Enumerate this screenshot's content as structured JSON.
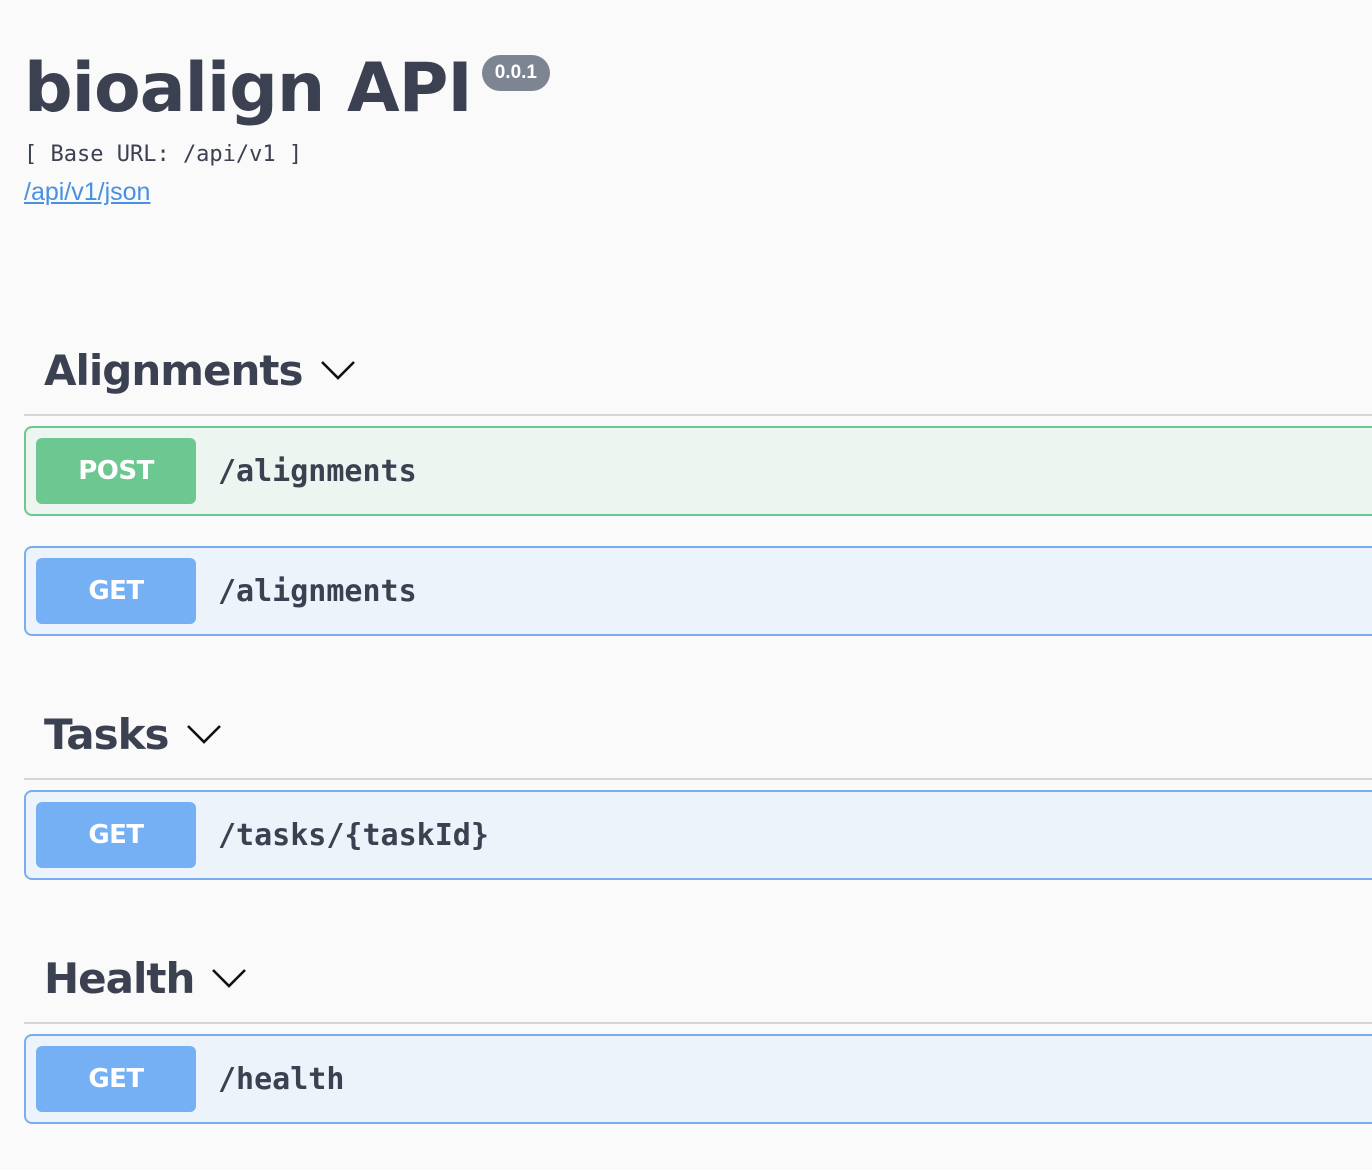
{
  "info": {
    "title": "bioalign API",
    "version": "0.0.1",
    "base_url": "[ Base URL: /api/v1 ]",
    "spec_link": "/api/v1/json"
  },
  "tags": [
    {
      "name": "Alignments",
      "operations": [
        {
          "method": "POST",
          "path": "/alignments"
        },
        {
          "method": "GET",
          "path": "/alignments"
        }
      ]
    },
    {
      "name": "Tasks",
      "operations": [
        {
          "method": "GET",
          "path": "/tasks/{taskId}"
        }
      ]
    },
    {
      "name": "Health",
      "operations": [
        {
          "method": "GET",
          "path": "/health"
        }
      ]
    }
  ],
  "colors": {
    "post": "#6cc791",
    "get": "#75b0f4",
    "link": "#4990e2",
    "version_badge": "#7d8492",
    "text": "#3b4151"
  },
  "icons": {
    "tag_toggle": "chevron-down-icon"
  }
}
